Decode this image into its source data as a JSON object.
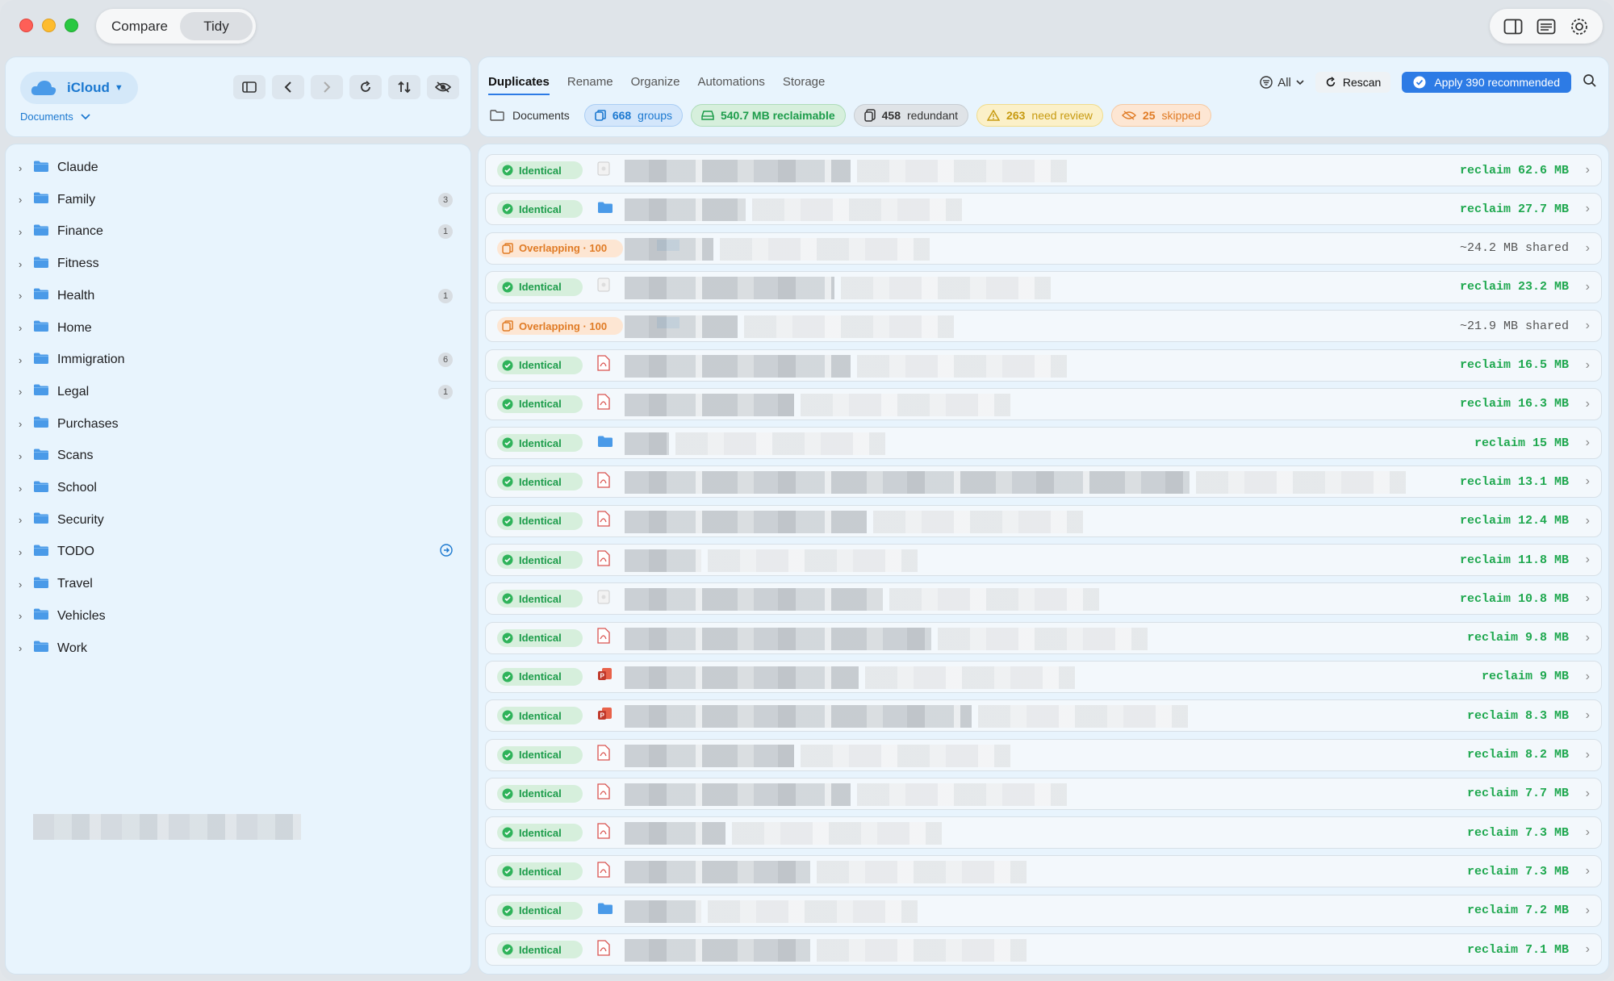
{
  "titlebar": {
    "segments": [
      "Compare",
      "Tidy"
    ],
    "selected_segment": "Tidy",
    "right_icons": [
      "sidebar-panel-icon",
      "list-view-icon",
      "settings-gear-icon"
    ]
  },
  "sidebar": {
    "location": "iCloud",
    "breadcrumb": "Documents",
    "tool_icons": [
      "sidebar-toggle-icon",
      "back-icon",
      "forward-icon",
      "refresh-icon",
      "sort-icon",
      "visibility-icon"
    ],
    "folders": [
      {
        "name": "Claude",
        "count": ""
      },
      {
        "name": "Family",
        "count": "3"
      },
      {
        "name": "Finance",
        "count": "1"
      },
      {
        "name": "Fitness",
        "count": ""
      },
      {
        "name": "Health",
        "count": "1"
      },
      {
        "name": "Home",
        "count": ""
      },
      {
        "name": "Immigration",
        "count": "6"
      },
      {
        "name": "Legal",
        "count": "1"
      },
      {
        "name": "Purchases",
        "count": ""
      },
      {
        "name": "Scans",
        "count": ""
      },
      {
        "name": "School",
        "count": ""
      },
      {
        "name": "Security",
        "count": ""
      },
      {
        "name": "TODO",
        "count": ""
      },
      {
        "name": "Travel",
        "count": ""
      },
      {
        "name": "Vehicles",
        "count": ""
      },
      {
        "name": "Work",
        "count": ""
      }
    ]
  },
  "main": {
    "tabs": [
      "Duplicates",
      "Rename",
      "Organize",
      "Automations",
      "Storage"
    ],
    "active_tab": "Duplicates",
    "filter_label": "All",
    "rescan_label": "Rescan",
    "apply_label": "Apply 390 recommended",
    "folder_label": "Documents",
    "chips": {
      "groups": {
        "value": "668",
        "label": "groups"
      },
      "reclaimable": {
        "value": "540.7 MB reclaimable",
        "label": ""
      },
      "redundant": {
        "value": "458",
        "label": "redundant"
      },
      "review": {
        "value": "263",
        "label": "need review"
      },
      "skipped": {
        "value": "25",
        "label": "skipped"
      }
    }
  },
  "rows": [
    {
      "status": "Identical",
      "type": "identical",
      "icon": "image",
      "amount": "reclaim 62.6 MB",
      "w": 1
    },
    {
      "status": "Identical",
      "type": "identical",
      "icon": "folder",
      "amount": "reclaim 27.7 MB",
      "w": 2
    },
    {
      "status": "Overlapping · 100",
      "type": "overlap",
      "icon": "none",
      "amount": "~24.2 MB shared",
      "w": 3
    },
    {
      "status": "Identical",
      "type": "identical",
      "icon": "image",
      "amount": "reclaim 23.2 MB",
      "w": 4
    },
    {
      "status": "Overlapping · 100",
      "type": "overlap",
      "icon": "none",
      "amount": "~21.9 MB shared",
      "w": 5
    },
    {
      "status": "Identical",
      "type": "identical",
      "icon": "pdf",
      "amount": "reclaim 16.5 MB",
      "w": 6
    },
    {
      "status": "Identical",
      "type": "identical",
      "icon": "pdf",
      "amount": "reclaim 16.3 MB",
      "w": 7
    },
    {
      "status": "Identical",
      "type": "identical",
      "icon": "folder",
      "amount": "reclaim 15 MB",
      "w": 8
    },
    {
      "status": "Identical",
      "type": "identical",
      "icon": "pdf",
      "amount": "reclaim 13.1 MB",
      "w": 9
    },
    {
      "status": "Identical",
      "type": "identical",
      "icon": "pdf",
      "amount": "reclaim 12.4 MB",
      "w": 10
    },
    {
      "status": "Identical",
      "type": "identical",
      "icon": "pdf",
      "amount": "reclaim 11.8 MB",
      "w": 11
    },
    {
      "status": "Identical",
      "type": "identical",
      "icon": "image",
      "amount": "reclaim 10.8 MB",
      "w": 12
    },
    {
      "status": "Identical",
      "type": "identical",
      "icon": "pdf",
      "amount": "reclaim 9.8 MB",
      "w": 13
    },
    {
      "status": "Identical",
      "type": "identical",
      "icon": "ppt",
      "amount": "reclaim 9 MB",
      "w": 14
    },
    {
      "status": "Identical",
      "type": "identical",
      "icon": "ppt",
      "amount": "reclaim 8.3 MB",
      "w": 15
    },
    {
      "status": "Identical",
      "type": "identical",
      "icon": "pdf",
      "amount": "reclaim 8.2 MB",
      "w": 16
    },
    {
      "status": "Identical",
      "type": "identical",
      "icon": "pdf",
      "amount": "reclaim 7.7 MB",
      "w": 17
    },
    {
      "status": "Identical",
      "type": "identical",
      "icon": "pdf",
      "amount": "reclaim 7.3 MB",
      "w": 18
    },
    {
      "status": "Identical",
      "type": "identical",
      "icon": "pdf",
      "amount": "reclaim 7.3 MB",
      "w": 19
    },
    {
      "status": "Identical",
      "type": "identical",
      "icon": "folder",
      "amount": "reclaim 7.2 MB",
      "w": 20
    },
    {
      "status": "Identical",
      "type": "identical",
      "icon": "pdf",
      "amount": "reclaim 7.1 MB",
      "w": 21
    }
  ]
}
